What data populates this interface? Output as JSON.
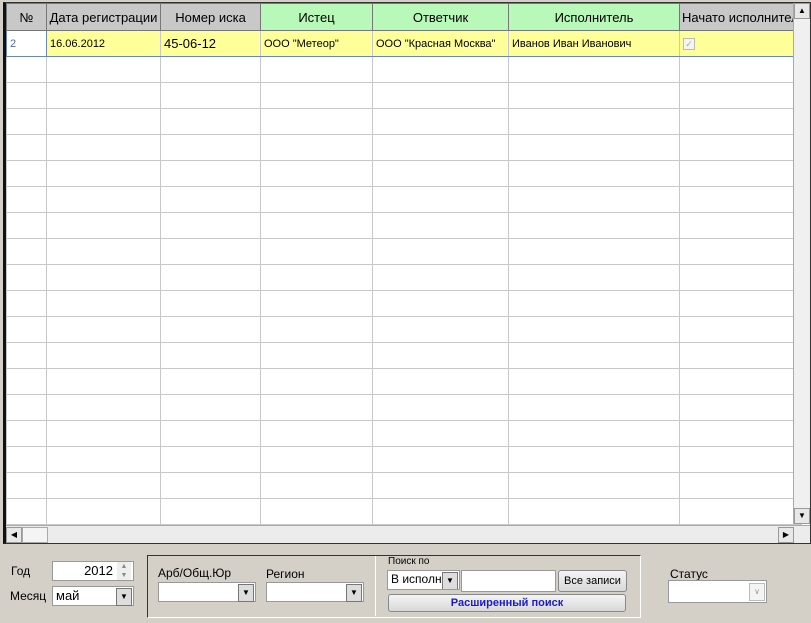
{
  "columns": [
    "№",
    "Дата регистрации",
    "Номер иска",
    "Истец",
    "Ответчик",
    "Исполнитель",
    "Начато исполнител"
  ],
  "rows": [
    {
      "num": "2",
      "date": "16.06.2012",
      "case": "45-06-12",
      "plaintiff": "ООО \"Метеор\"",
      "defendant": "ООО \"Красная Москва\"",
      "executor": "Иванов Иван Иванович",
      "started": true
    }
  ],
  "filters": {
    "year_label": "Год",
    "year_value": "2012",
    "month_label": "Месяц",
    "month_value": "май",
    "arb_label": "Арб/Общ.Юр",
    "region_label": "Регион",
    "search_label": "Поиск по",
    "search_by_value": "В исполн",
    "search_text": "",
    "all_records": "Все записи",
    "advanced_search": "Расширенный поиск",
    "status_label": "Статус"
  }
}
